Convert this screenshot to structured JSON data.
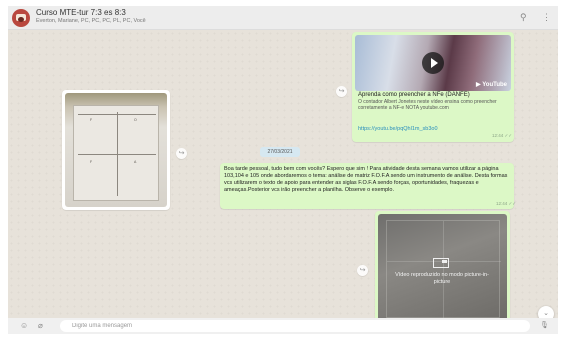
{
  "header": {
    "title": "Curso MTE-tur 7:3 es 8:3",
    "subtitle": "Everton, Mariane, PC, PC, PC, PL, PC, Você",
    "search_icon": "⚲",
    "menu_icon": "⋮"
  },
  "messages": {
    "link_preview": {
      "title": "Aprenda como preencher a NFe (DANFE)",
      "description": "O contador Albert Jonetes neste vídeo ensina como preencher corretamente a NF-e NOTA youtube.com",
      "link": "https://youtu.be/pqQhl1m_sb3o0",
      "time": "12:44 ✓✓",
      "yt_label": "▶ YouTube"
    },
    "date_chip": "27/03/2021",
    "text_message": {
      "text": "Boa tarde pessoal, tudo bem com vocês? Espero que sim ! Para atividade desta semana vamos utilizar a página 103,104 e 105 onde abordaremos o tema: análise de matriz F.O.F.A sendo um instrumento de análise. Desta formas vcs utilizarem o texto de apoio para entender as siglas F.O.F.A sendo forças, oportunidades, fraquezas e ameaças.Posterior vcs irão preencher a planilha.  Observe o exemplo.",
      "time": "12:44 ✓✓"
    },
    "video_message": {
      "pip_text": "Vídeo reproduzido no modo picture-in-picture"
    },
    "doc_labels": [
      "F",
      "O",
      "F",
      "A"
    ]
  },
  "composer": {
    "emoji_icon": "☺",
    "attach_icon": "⌀",
    "placeholder": "Digite uma mensagem",
    "mic_icon": "🎙"
  },
  "icons": {
    "forward": "↪",
    "scroll_down": "⌄"
  },
  "colors": {
    "outgoing_bubble": "#dcf8c6",
    "chat_background": "#e7e2da",
    "link": "#2a8fbd"
  }
}
